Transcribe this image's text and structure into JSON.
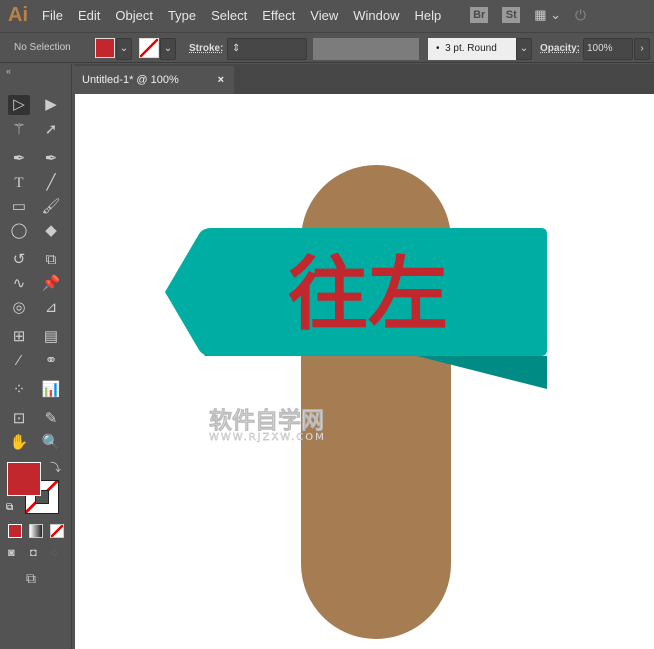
{
  "app": {
    "logo": "Ai"
  },
  "menu": [
    "File",
    "Edit",
    "Object",
    "Type",
    "Select",
    "Effect",
    "View",
    "Window",
    "Help"
  ],
  "menu_icons": {
    "bridge": "Br",
    "stock": "St"
  },
  "control": {
    "selection": "No Selection",
    "stroke_label": "Stroke:",
    "brush": "3 pt. Round",
    "opacity_label": "Opacity:",
    "opacity": "100%"
  },
  "tab": {
    "title": "Untitled-1* @ 100% (RGB/Preview)",
    "close": "×"
  },
  "artwork": {
    "sign_text": "往左",
    "watermark": "软件自学网",
    "watermark_url": "WWW.RJZXW.COM"
  },
  "colors": {
    "fill": "#C1272D",
    "post": "#A67C52",
    "sign_top": "#00ADA3",
    "sign_side": "#008C84"
  }
}
